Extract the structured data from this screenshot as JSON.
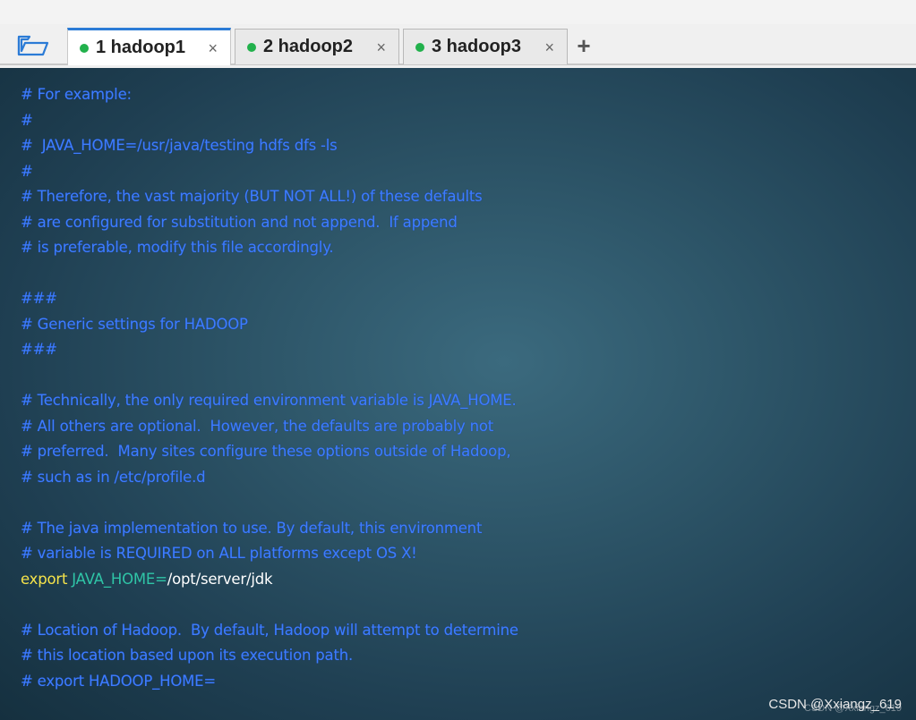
{
  "tabs": [
    {
      "label": "1 hadoop1",
      "active": true,
      "status_color": "#22b14c"
    },
    {
      "label": "2 hadoop2",
      "active": false,
      "status_color": "#22b14c"
    },
    {
      "label": "3 hadoop3",
      "active": false,
      "status_color": "#22b14c"
    }
  ],
  "icons": {
    "folder": "folder-open-icon",
    "close": "close-icon",
    "add": "plus-icon"
  },
  "close_glyph": "×",
  "add_glyph": "+",
  "terminal": {
    "lines": [
      "# For example:",
      "#",
      "#  JAVA_HOME=/usr/java/testing hdfs dfs -ls",
      "#",
      "# Therefore, the vast majority (BUT NOT ALL!) of these defaults",
      "# are configured for substitution and not append.  If append",
      "# is preferable, modify this file accordingly.",
      "",
      "###",
      "# Generic settings for HADOOP",
      "###",
      "",
      "# Technically, the only required environment variable is JAVA_HOME.",
      "# All others are optional.  However, the defaults are probably not",
      "# preferred.  Many sites configure these options outside of Hadoop,",
      "# such as in /etc/profile.d",
      "",
      "# The java implementation to use. By default, this environment",
      "# variable is REQUIRED on ALL platforms except OS X!",
      "",
      "",
      "# Location of Hadoop.  By default, Hadoop will attempt to determine",
      "# this location based upon its execution path.",
      "# export HADOOP_HOME="
    ],
    "export_line": {
      "keyword": "export",
      "variable": "JAVA_HOME",
      "equals": "=",
      "value": "/opt/server/jdk"
    },
    "colors": {
      "comment": "#3d7dff",
      "keyword": "#f5e34a",
      "variable": "#2fc5a7",
      "text": "#ffffff"
    }
  },
  "watermark": "CSDN @Xxiangz_619",
  "watermark_small": "CSDN @Xxiangz_619"
}
